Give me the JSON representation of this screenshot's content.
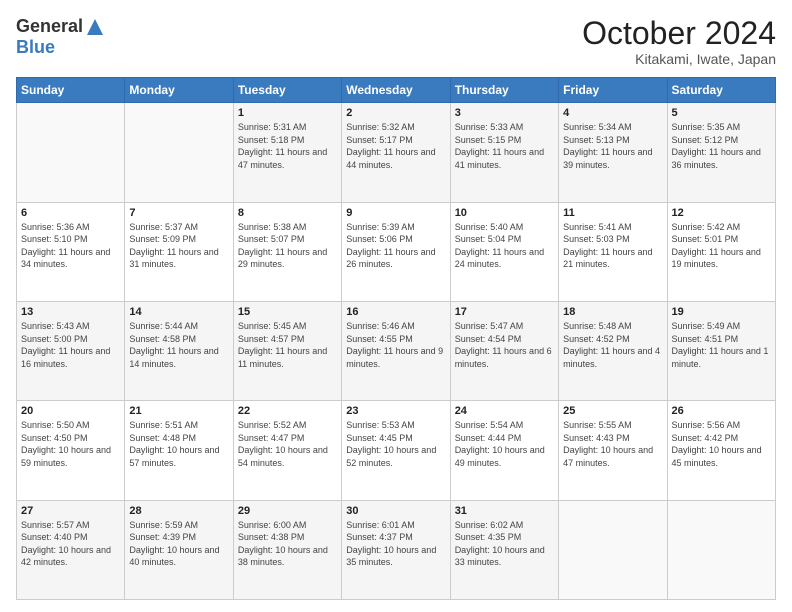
{
  "header": {
    "title": "October 2024",
    "subtitle": "Kitakami, Iwate, Japan",
    "logo_general": "General",
    "logo_blue": "Blue"
  },
  "calendar": {
    "days": [
      "Sunday",
      "Monday",
      "Tuesday",
      "Wednesday",
      "Thursday",
      "Friday",
      "Saturday"
    ],
    "weeks": [
      [
        {
          "day": "",
          "sunrise": "",
          "sunset": "",
          "daylight": ""
        },
        {
          "day": "",
          "sunrise": "",
          "sunset": "",
          "daylight": ""
        },
        {
          "day": "1",
          "sunrise": "Sunrise: 5:31 AM",
          "sunset": "Sunset: 5:18 PM",
          "daylight": "Daylight: 11 hours and 47 minutes."
        },
        {
          "day": "2",
          "sunrise": "Sunrise: 5:32 AM",
          "sunset": "Sunset: 5:17 PM",
          "daylight": "Daylight: 11 hours and 44 minutes."
        },
        {
          "day": "3",
          "sunrise": "Sunrise: 5:33 AM",
          "sunset": "Sunset: 5:15 PM",
          "daylight": "Daylight: 11 hours and 41 minutes."
        },
        {
          "day": "4",
          "sunrise": "Sunrise: 5:34 AM",
          "sunset": "Sunset: 5:13 PM",
          "daylight": "Daylight: 11 hours and 39 minutes."
        },
        {
          "day": "5",
          "sunrise": "Sunrise: 5:35 AM",
          "sunset": "Sunset: 5:12 PM",
          "daylight": "Daylight: 11 hours and 36 minutes."
        }
      ],
      [
        {
          "day": "6",
          "sunrise": "Sunrise: 5:36 AM",
          "sunset": "Sunset: 5:10 PM",
          "daylight": "Daylight: 11 hours and 34 minutes."
        },
        {
          "day": "7",
          "sunrise": "Sunrise: 5:37 AM",
          "sunset": "Sunset: 5:09 PM",
          "daylight": "Daylight: 11 hours and 31 minutes."
        },
        {
          "day": "8",
          "sunrise": "Sunrise: 5:38 AM",
          "sunset": "Sunset: 5:07 PM",
          "daylight": "Daylight: 11 hours and 29 minutes."
        },
        {
          "day": "9",
          "sunrise": "Sunrise: 5:39 AM",
          "sunset": "Sunset: 5:06 PM",
          "daylight": "Daylight: 11 hours and 26 minutes."
        },
        {
          "day": "10",
          "sunrise": "Sunrise: 5:40 AM",
          "sunset": "Sunset: 5:04 PM",
          "daylight": "Daylight: 11 hours and 24 minutes."
        },
        {
          "day": "11",
          "sunrise": "Sunrise: 5:41 AM",
          "sunset": "Sunset: 5:03 PM",
          "daylight": "Daylight: 11 hours and 21 minutes."
        },
        {
          "day": "12",
          "sunrise": "Sunrise: 5:42 AM",
          "sunset": "Sunset: 5:01 PM",
          "daylight": "Daylight: 11 hours and 19 minutes."
        }
      ],
      [
        {
          "day": "13",
          "sunrise": "Sunrise: 5:43 AM",
          "sunset": "Sunset: 5:00 PM",
          "daylight": "Daylight: 11 hours and 16 minutes."
        },
        {
          "day": "14",
          "sunrise": "Sunrise: 5:44 AM",
          "sunset": "Sunset: 4:58 PM",
          "daylight": "Daylight: 11 hours and 14 minutes."
        },
        {
          "day": "15",
          "sunrise": "Sunrise: 5:45 AM",
          "sunset": "Sunset: 4:57 PM",
          "daylight": "Daylight: 11 hours and 11 minutes."
        },
        {
          "day": "16",
          "sunrise": "Sunrise: 5:46 AM",
          "sunset": "Sunset: 4:55 PM",
          "daylight": "Daylight: 11 hours and 9 minutes."
        },
        {
          "day": "17",
          "sunrise": "Sunrise: 5:47 AM",
          "sunset": "Sunset: 4:54 PM",
          "daylight": "Daylight: 11 hours and 6 minutes."
        },
        {
          "day": "18",
          "sunrise": "Sunrise: 5:48 AM",
          "sunset": "Sunset: 4:52 PM",
          "daylight": "Daylight: 11 hours and 4 minutes."
        },
        {
          "day": "19",
          "sunrise": "Sunrise: 5:49 AM",
          "sunset": "Sunset: 4:51 PM",
          "daylight": "Daylight: 11 hours and 1 minute."
        }
      ],
      [
        {
          "day": "20",
          "sunrise": "Sunrise: 5:50 AM",
          "sunset": "Sunset: 4:50 PM",
          "daylight": "Daylight: 10 hours and 59 minutes."
        },
        {
          "day": "21",
          "sunrise": "Sunrise: 5:51 AM",
          "sunset": "Sunset: 4:48 PM",
          "daylight": "Daylight: 10 hours and 57 minutes."
        },
        {
          "day": "22",
          "sunrise": "Sunrise: 5:52 AM",
          "sunset": "Sunset: 4:47 PM",
          "daylight": "Daylight: 10 hours and 54 minutes."
        },
        {
          "day": "23",
          "sunrise": "Sunrise: 5:53 AM",
          "sunset": "Sunset: 4:45 PM",
          "daylight": "Daylight: 10 hours and 52 minutes."
        },
        {
          "day": "24",
          "sunrise": "Sunrise: 5:54 AM",
          "sunset": "Sunset: 4:44 PM",
          "daylight": "Daylight: 10 hours and 49 minutes."
        },
        {
          "day": "25",
          "sunrise": "Sunrise: 5:55 AM",
          "sunset": "Sunset: 4:43 PM",
          "daylight": "Daylight: 10 hours and 47 minutes."
        },
        {
          "day": "26",
          "sunrise": "Sunrise: 5:56 AM",
          "sunset": "Sunset: 4:42 PM",
          "daylight": "Daylight: 10 hours and 45 minutes."
        }
      ],
      [
        {
          "day": "27",
          "sunrise": "Sunrise: 5:57 AM",
          "sunset": "Sunset: 4:40 PM",
          "daylight": "Daylight: 10 hours and 42 minutes."
        },
        {
          "day": "28",
          "sunrise": "Sunrise: 5:59 AM",
          "sunset": "Sunset: 4:39 PM",
          "daylight": "Daylight: 10 hours and 40 minutes."
        },
        {
          "day": "29",
          "sunrise": "Sunrise: 6:00 AM",
          "sunset": "Sunset: 4:38 PM",
          "daylight": "Daylight: 10 hours and 38 minutes."
        },
        {
          "day": "30",
          "sunrise": "Sunrise: 6:01 AM",
          "sunset": "Sunset: 4:37 PM",
          "daylight": "Daylight: 10 hours and 35 minutes."
        },
        {
          "day": "31",
          "sunrise": "Sunrise: 6:02 AM",
          "sunset": "Sunset: 4:35 PM",
          "daylight": "Daylight: 10 hours and 33 minutes."
        },
        {
          "day": "",
          "sunrise": "",
          "sunset": "",
          "daylight": ""
        },
        {
          "day": "",
          "sunrise": "",
          "sunset": "",
          "daylight": ""
        }
      ]
    ]
  }
}
